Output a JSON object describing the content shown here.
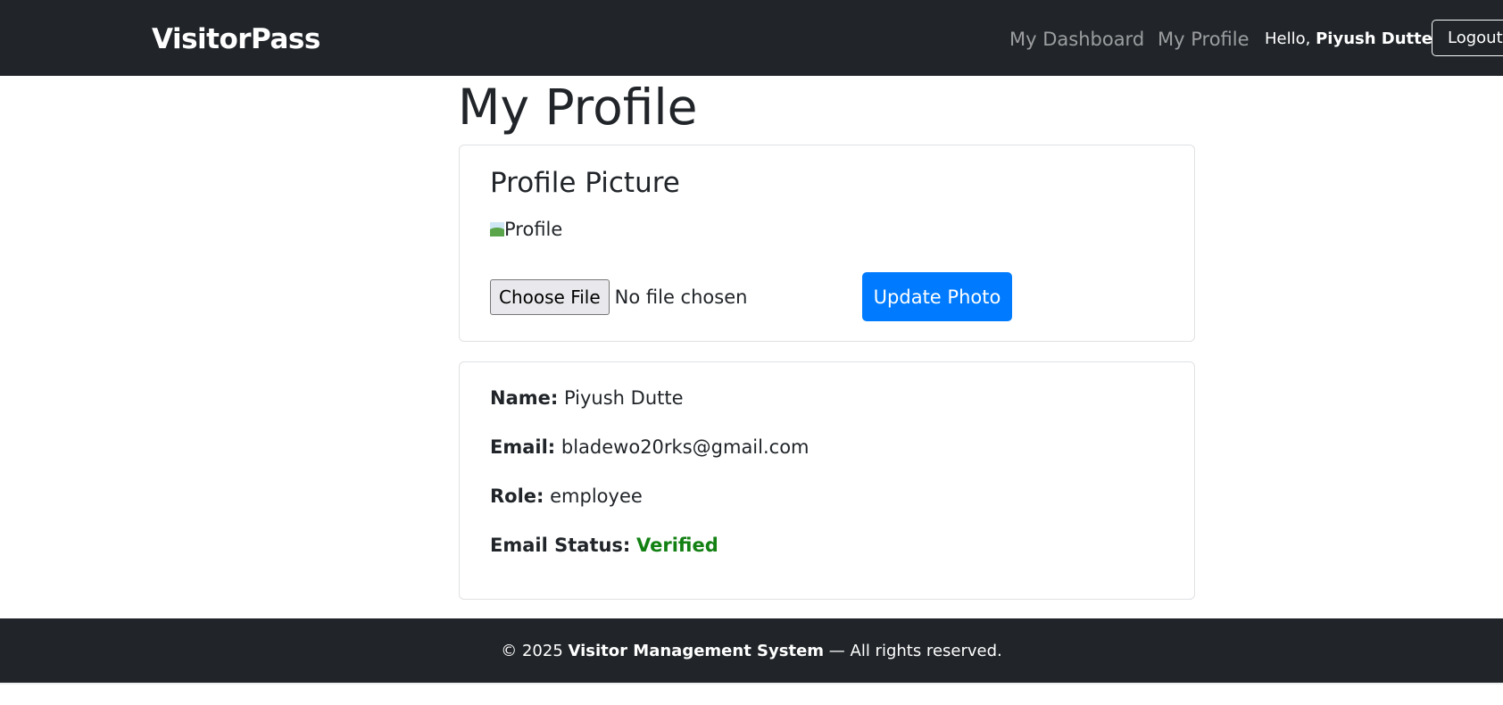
{
  "navbar": {
    "brand": "VisitorPass",
    "links": [
      {
        "label": "My Dashboard"
      },
      {
        "label": "My Profile"
      }
    ],
    "greeting": "Hello,",
    "user_name": "Piyush Dutte",
    "logout_label": "Logout"
  },
  "page": {
    "title": "My Profile"
  },
  "photo_card": {
    "heading": "Profile Picture",
    "image_alt": "Profile",
    "choose_file_label": "Choose File",
    "file_status": "No file chosen",
    "update_label": "Update Photo"
  },
  "info_card": {
    "rows": [
      {
        "label": "Name:",
        "value": "Piyush Dutte"
      },
      {
        "label": "Email:",
        "value": "bladewo20rks@gmail.com"
      },
      {
        "label": "Role:",
        "value": "employee"
      },
      {
        "label": "Email Status:",
        "value": "Verified",
        "value_color": "#128012"
      }
    ]
  },
  "footer": {
    "copyright": "© 2025",
    "org": "Visitor Management System",
    "rights": "— All rights reserved."
  },
  "colors": {
    "navbar_bg": "#212529",
    "primary": "#007bff",
    "success": "#128012"
  }
}
